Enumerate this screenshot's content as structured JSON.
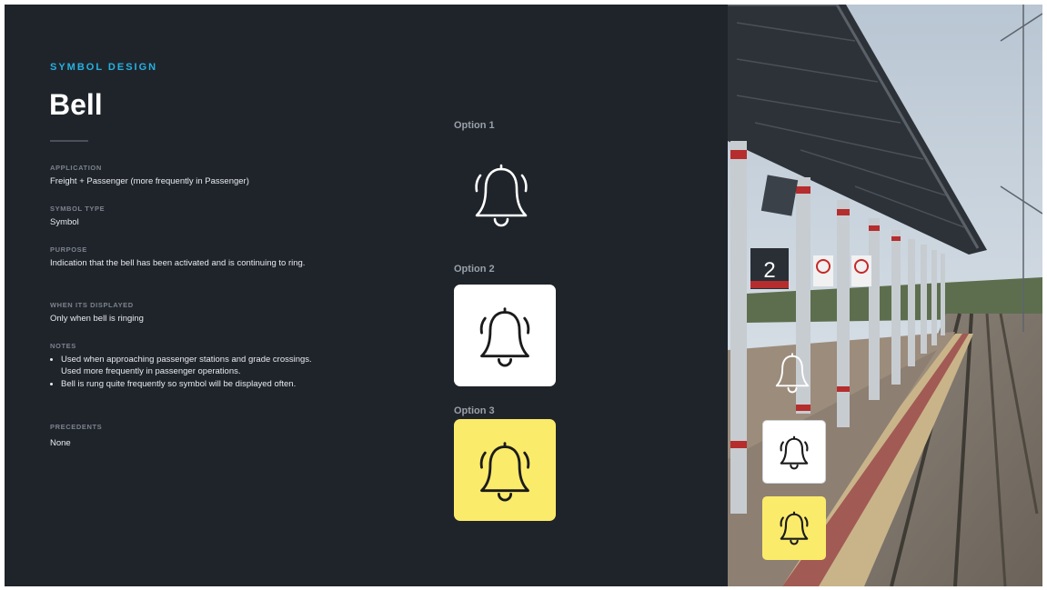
{
  "header": {
    "eyebrow": "SYMBOL DESIGN",
    "title": "Bell"
  },
  "fields": {
    "application": {
      "label": "APPLICATION",
      "value": "Freight + Passenger (more frequently in Passenger)"
    },
    "symbol_type": {
      "label": "SYMBOL TYPE",
      "value": "Symbol"
    },
    "purpose": {
      "label": "PURPOSE",
      "value": "Indication that the bell has been activated and is continuing to ring."
    },
    "when_displayed": {
      "label": "WHEN ITS DISPLAYED",
      "value": "Only when bell is ringing"
    },
    "notes": {
      "label": "NOTES",
      "items": [
        "Used when approaching passenger stations and grade crossings. Used more frequently in passenger operations.",
        "Bell is rung quite frequently so symbol will be displayed often."
      ]
    },
    "precedents": {
      "label": "PRECEDENTS",
      "value": "None"
    }
  },
  "options": [
    {
      "label": "Option 1",
      "style": "outline-on-dark"
    },
    {
      "label": "Option 2",
      "style": "on-white-tile"
    },
    {
      "label": "Option 3",
      "style": "on-yellow-tile"
    }
  ],
  "photo": {
    "platform_number": "2",
    "icon": "bell-icon"
  },
  "colors": {
    "background": "#1f242b",
    "accent": "#25b1e0",
    "tile_white": "#ffffff",
    "tile_yellow": "#fbeb6a"
  }
}
